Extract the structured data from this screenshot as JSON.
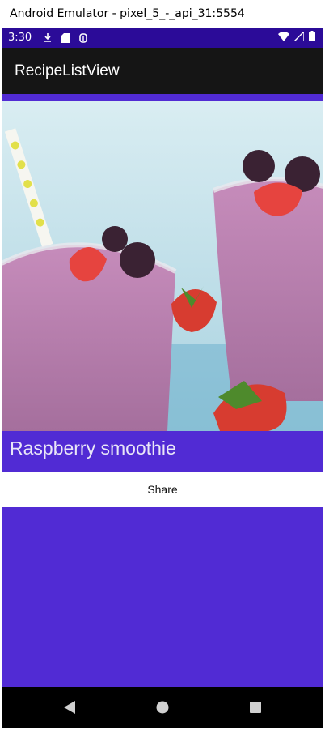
{
  "window": {
    "title": "Android Emulator - pixel_5_-_api_31:5554"
  },
  "status_bar": {
    "time": "3:30"
  },
  "app_bar": {
    "title": "RecipeListView"
  },
  "recipe": {
    "title": "Raspberry smoothie"
  },
  "actions": {
    "share_label": "Share"
  },
  "colors": {
    "primary": "#512bd4",
    "status_bar": "#2b0b98",
    "app_bar": "#151515",
    "nav_bar": "#000000"
  },
  "icons": {
    "status_left": [
      "download-icon",
      "sd-card-icon",
      "sync-icon"
    ],
    "status_right": [
      "wifi-icon",
      "signal-icon",
      "battery-icon"
    ],
    "nav": [
      "back-icon",
      "home-icon",
      "recents-icon"
    ]
  }
}
